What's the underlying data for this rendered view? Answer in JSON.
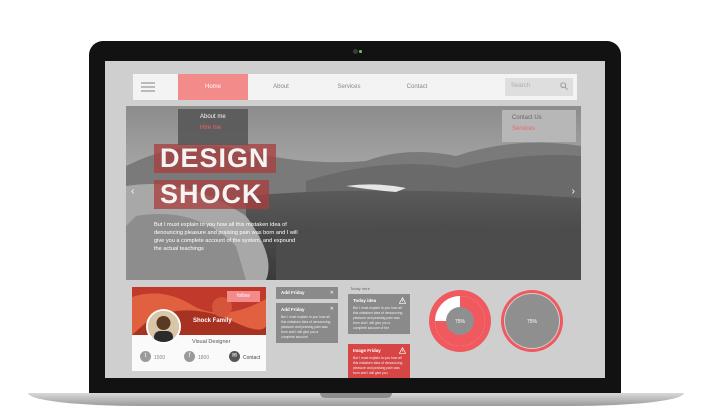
{
  "nav": {
    "items": [
      "Home",
      "About",
      "Services",
      "Contact"
    ],
    "active": "Home",
    "search_placeholder": "Search"
  },
  "dropdown_left": {
    "items": [
      "About me",
      "Hire me"
    ]
  },
  "dropdown_right": {
    "items": [
      "Contact Us",
      "Services"
    ]
  },
  "hero": {
    "headline_line1": "DESIGN",
    "headline_line2": "SHOCK",
    "body": "But I must explain to you how all this mistaken idea of denouncing pleasure and praising pain was born and I will give you a complete account of the system, and expound the actual teachings"
  },
  "profile": {
    "follow_label": "follow",
    "name": "Shock Family",
    "role": "Visual Designer",
    "twitter_count": "1500",
    "facebook_count": "1800",
    "contact_label": "Contact"
  },
  "cards": {
    "card1_title": "Add Friday",
    "card2_title": "Add Friday",
    "card2_body": "But I must explain to you how all this mistaken idea of denouncing pleasure and praising pain was born and I will give you a complete account",
    "today_label": "Today here",
    "card3_title": "Today idea",
    "card3_body": "But I must explain to you how all this mistaken idea of denouncing pleasure and praising pain was born and I will give you a complete account of the",
    "card4_title": "Image Friday",
    "card4_body": "But I must explain to you how all this mistaken idea of denouncing pleasure and praising pain was born and I will give you"
  },
  "gauges": [
    {
      "label": "75%",
      "fraction": 0.75,
      "color": "#f05a5f"
    },
    {
      "label": "75%",
      "fraction": 0.75,
      "color": "#f05a5f"
    }
  ],
  "colors": {
    "accent": "#f48b8b",
    "red": "#f05a5f"
  }
}
